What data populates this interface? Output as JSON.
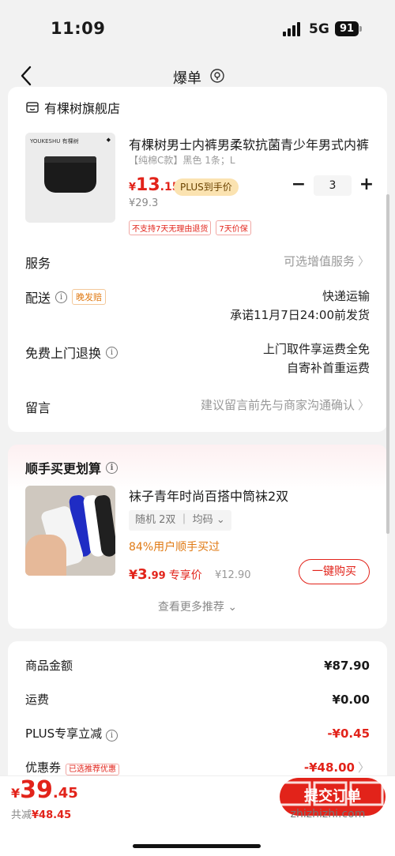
{
  "status": {
    "time": "11:09",
    "network": "5G",
    "battery": "91"
  },
  "nav": {
    "title": "爆单"
  },
  "shop": {
    "name": "有棵树旗舰店"
  },
  "product": {
    "brand": "YOUKESHU 有棵树",
    "title": "有棵树男士内裤男柔软抗菌青少年男式内裤",
    "spec": "【纯棉C款】黑色 1条；L",
    "price_currency": "¥",
    "price_int": "13",
    "price_dec": ".15",
    "plus_tag": "PLUS到手价",
    "orig_price": "¥29.3",
    "qty": "3",
    "minus": "−",
    "plus": "+",
    "tags": [
      "不支持7天无理由退货",
      "7天价保"
    ]
  },
  "service": {
    "label": "服务",
    "value": "可选增值服务"
  },
  "delivery": {
    "label": "配送",
    "tag": "晚发赔",
    "line1": "快递运输",
    "line2": "承诺11月7日24:00前发货"
  },
  "return_pickup": {
    "label": "免费上门退换",
    "line1": "上门取件享运费全免",
    "line2": "自寄补首重运费"
  },
  "message": {
    "label": "留言",
    "placeholder": "建议留言前先与商家沟通确认"
  },
  "addon": {
    "title": "顺手买更划算",
    "product_title": "袜子青年时尚百搭中筒袜2双",
    "spec": "随机 2双 ｜ 均码",
    "note": "84%用户顺手买过",
    "price_currency": "¥",
    "price_int": "3",
    "price_dec": ".99",
    "price_label": "专享价",
    "orig_price": "¥12.90",
    "buy_label": "一键购买",
    "more_label": "查看更多推荐"
  },
  "summary": {
    "goods_label": "商品金额",
    "goods_value": "¥87.90",
    "freight_label": "运费",
    "freight_value": "¥0.00",
    "plus_label": "PLUS专享立减",
    "plus_value": "-¥0.45",
    "coupon_label": "优惠券",
    "coupon_tag": "已选推荐优惠",
    "coupon_value": "-¥48.00"
  },
  "bottom": {
    "total_currency": "¥",
    "total_int": "39",
    "total_dec": ".45",
    "saved_label": "共减",
    "saved_value": "¥48.45",
    "submit_label": "提交订单",
    "watermark": "zhizhizhi.com"
  },
  "colors": {
    "accent": "#e2231a",
    "plus_gold": "#fbe3b1",
    "orange": "#e07a14"
  }
}
